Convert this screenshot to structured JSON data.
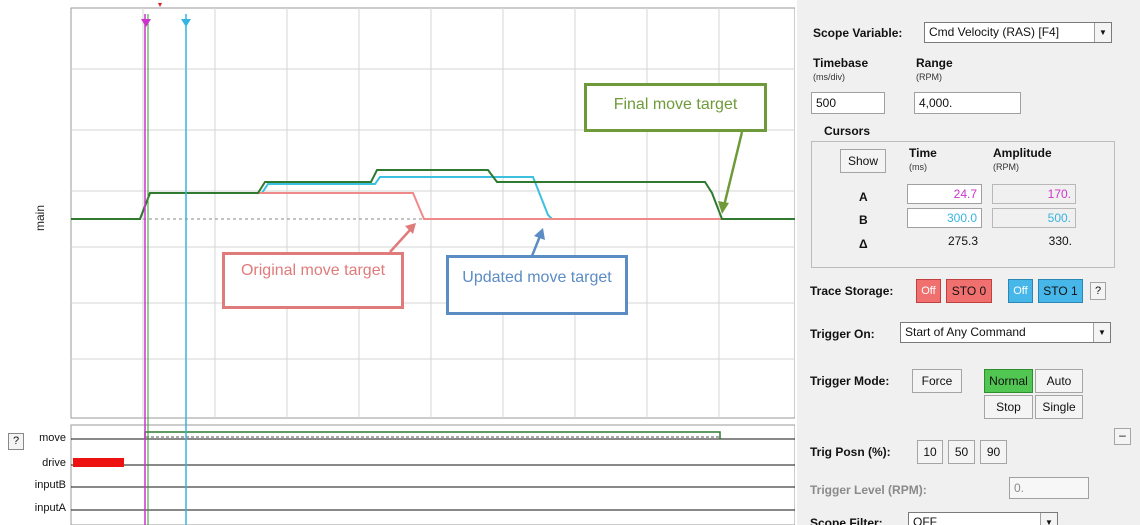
{
  "plot": {
    "y_label": "main",
    "callouts": {
      "final": "Final move target",
      "original": "Original move target",
      "updated": "Updated move target"
    },
    "digital_channels": [
      "move",
      "drive",
      "inputB",
      "inputA"
    ],
    "help_label": "?",
    "colors": {
      "final_trace": "#2f7a2f",
      "original_trace": "#ef8a8a",
      "updated_trace": "#3cc0df",
      "cursor_a": "#cc33cc",
      "cursor_b": "#37b4e0",
      "drive_bar": "#ee1111"
    }
  },
  "panel": {
    "scope_variable_label": "Scope Variable:",
    "scope_variable_value": "Cmd Velocity (RAS) [F4]",
    "timebase_label": "Timebase",
    "timebase_unit": "(ms/div)",
    "timebase_value": "500",
    "range_label": "Range",
    "range_unit": "(RPM)",
    "range_value": "4,000.",
    "cursors": {
      "title": "Cursors",
      "show_label": "Show",
      "time_header": "Time",
      "time_unit": "(ms)",
      "amplitude_header": "Amplitude",
      "amplitude_unit": "(RPM)",
      "row_a": "A",
      "row_b": "B",
      "row_delta": "Δ",
      "a_time": "24.7",
      "a_amp": "170.",
      "b_time": "300.0",
      "b_amp": "500.",
      "delta_time": "275.3",
      "delta_amp": "330."
    },
    "trace_storage_label": "Trace Storage:",
    "sto0_off": "Off",
    "sto0_label": "STO 0",
    "sto1_off": "Off",
    "sto1_label": "STO 1",
    "trace_help": "?",
    "trigger_on_label": "Trigger On:",
    "trigger_on_value": "Start of Any Command",
    "trigger_mode_label": "Trigger Mode:",
    "force_label": "Force",
    "normal_label": "Normal",
    "auto_label": "Auto",
    "stop_label": "Stop",
    "single_label": "Single",
    "minimize_label": "–",
    "trig_posn_label": "Trig Posn (%):",
    "trig_posn_options": [
      "10",
      "50",
      "90"
    ],
    "trigger_level_label": "Trigger Level (RPM):",
    "trigger_level_value": "0.",
    "scope_filter_label": "Scope Filter:",
    "scope_filter_value": "OFF"
  }
}
